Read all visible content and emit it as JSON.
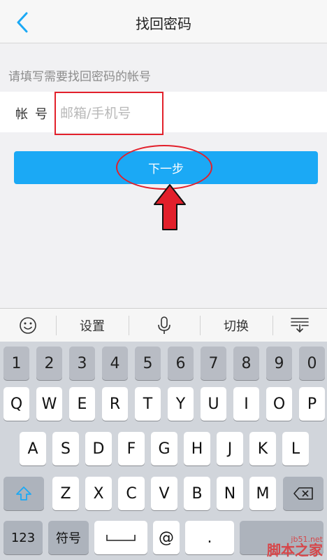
{
  "nav": {
    "title": "找回密码"
  },
  "form": {
    "hint": "请填写需要找回密码的帐号",
    "account_label": "帐号",
    "account_placeholder": "邮箱/手机号",
    "next_label": "下一步"
  },
  "keyboard_toolbar": {
    "settings_label": "设置",
    "switch_label": "切换"
  },
  "keyboard": {
    "number_row": [
      "1",
      "2",
      "3",
      "4",
      "5",
      "6",
      "7",
      "8",
      "9",
      "0"
    ],
    "row1": [
      "Q",
      "W",
      "E",
      "R",
      "T",
      "Y",
      "U",
      "I",
      "O",
      "P"
    ],
    "row2": [
      "A",
      "S",
      "D",
      "F",
      "G",
      "H",
      "J",
      "K",
      "L"
    ],
    "row3": [
      "Z",
      "X",
      "C",
      "V",
      "B",
      "N",
      "M"
    ],
    "bottom": {
      "num_label": "123",
      "symbol_label": "符号",
      "at_label": "@",
      "dot_label": "."
    }
  },
  "watermark": {
    "url": "jb51.net",
    "name": "脚本之家"
  },
  "colors": {
    "accent": "#1ba9f5",
    "annotation": "#e2202b"
  }
}
